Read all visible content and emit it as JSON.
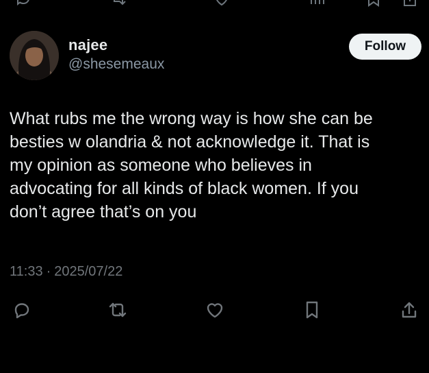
{
  "author": {
    "display_name": "najee",
    "handle": "@shesemeaux",
    "avatar_icon": "profile-photo"
  },
  "follow_button": {
    "label": "Follow"
  },
  "tweet": {
    "text": "What rubs me the wrong way is how she can be\nbesties w olandria & not acknowledge it. That is\nmy opinion as someone who believes in\nadvocating for all kinds of black women. If you\ndon’t agree that’s on you",
    "time": "11:33",
    "separator": "·",
    "date": "2025/07/22"
  },
  "actions": {
    "icons": [
      "reply-icon",
      "retweet-icon",
      "like-icon",
      "bookmark-icon",
      "share-icon"
    ]
  },
  "colors": {
    "background": "#000000",
    "text_primary": "#e7e9ea",
    "text_secondary": "#71767b",
    "follow_bg": "#eff3f4",
    "follow_text": "#0f1419"
  }
}
